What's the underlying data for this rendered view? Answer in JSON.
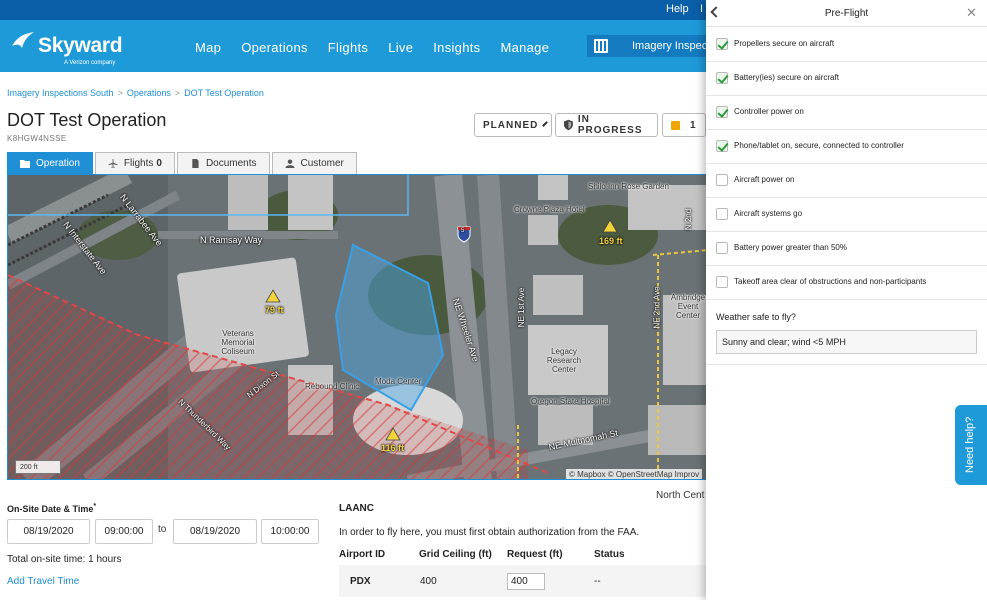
{
  "utility": {
    "help": "Help",
    "sep": "I"
  },
  "brand": {
    "name": "Skyward",
    "tagline": "A Verizon company"
  },
  "nav": {
    "items": [
      "Map",
      "Operations",
      "Flights",
      "Live",
      "Insights",
      "Manage"
    ],
    "org": "Imagery Inspectio"
  },
  "breadcrumb": [
    "Imagery Inspections South",
    "Operations",
    "DOT Test Operation"
  ],
  "operation": {
    "title": "DOT Test Operation",
    "id": "K8HGW4NSSE"
  },
  "status": {
    "planned": "PLANNED",
    "in_progress": "IN PROGRESS",
    "count": "1"
  },
  "tabs": [
    {
      "label": "Operation",
      "count": ""
    },
    {
      "label": "Flights",
      "count": "0"
    },
    {
      "label": "Documents",
      "count": ""
    },
    {
      "label": "Customer",
      "count": ""
    }
  ],
  "map": {
    "labels": {
      "larrabee": "N Larrabee Ave",
      "interstate": "N Interstate Ave",
      "ramsay": "N Ramsay Way",
      "veterans": "Veterans Memorial Coliseum",
      "moda": "Moda Center",
      "rebound": "Rebound Clinic",
      "wheeler": "NE Wheeler Ave",
      "dixon": "N Dixon St",
      "thunderbird": "N Thunderbird Way",
      "crowne": "Crowne Plaza Hotel",
      "shilo": "Shilo Inn Rose Garden",
      "legacy": "Legacy Research Center",
      "oregon": "Oregon State Hospital",
      "multnomah": "NE Multnomah St",
      "ambridge": "Ambridge Event Center",
      "first": "NE 1st Ave",
      "second": "NE 2nd Ave",
      "second2": "N 2nd"
    },
    "heights": {
      "h79": "79 ft",
      "h169": "169 ft",
      "h116": "116 ft"
    },
    "scale": "200 ft",
    "attribution": "© Mapbox © OpenStreetMap Improv",
    "shield_number": "5"
  },
  "region_label": "North Cent",
  "schedule": {
    "label": "On-Site Date & Time",
    "required_mark": "*",
    "start_date": "08/19/2020",
    "start_time": "09:00:00",
    "to": "to",
    "end_date": "08/19/2020",
    "end_time": "10:00:00",
    "total": "Total on-site time: 1 hours",
    "add_travel": "Add Travel Time"
  },
  "laanc": {
    "heading": "LAANC",
    "note": "In order to fly here, you must first obtain authorization from the FAA.",
    "columns": [
      "Airport ID",
      "Grid Ceiling (ft)",
      "Request (ft)",
      "Status"
    ],
    "row": {
      "airport": "PDX",
      "ceiling": "400",
      "request": "400",
      "status": "--"
    }
  },
  "preflight": {
    "title": "Pre-Flight",
    "items": [
      {
        "label": "Propellers secure on aircraft",
        "checked": true
      },
      {
        "label": "Battery(ies) secure on aircraft",
        "checked": true
      },
      {
        "label": "Controller power on",
        "checked": true
      },
      {
        "label": "Phone/tablet on, secure, connected to controller",
        "checked": true
      },
      {
        "label": "Aircraft power on",
        "checked": false
      },
      {
        "label": "Aircraft systems go",
        "checked": false
      },
      {
        "label": "Battery power greater than 50%",
        "checked": false
      },
      {
        "label": "Takeoff area clear of obstructions and non-participants",
        "checked": false
      }
    ],
    "weather_label": "Weather safe to fly?",
    "weather_value": "Sunny and clear; wind <5 MPH"
  },
  "help_tab": "Need help?",
  "colors": {
    "brand": "#1f9ad9",
    "brand_dark": "#0a5fa8",
    "check": "#2e9a3e",
    "airspace": "#d43b3b",
    "zone": "#3aa0e6"
  }
}
